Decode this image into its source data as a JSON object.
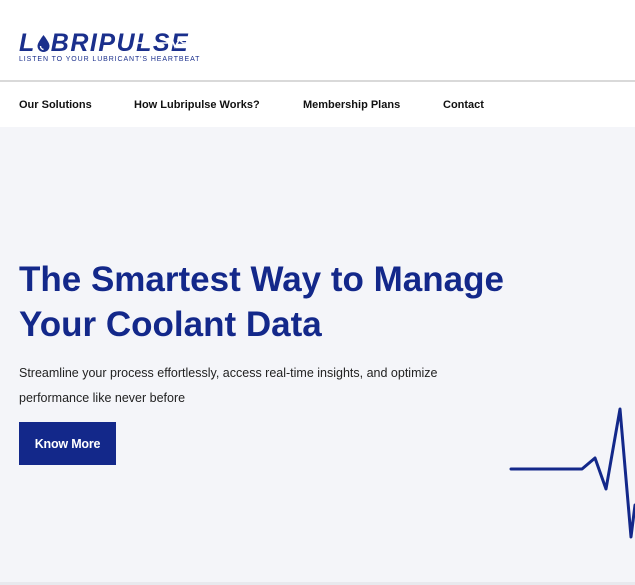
{
  "brand": {
    "wordmark_prefix": "L",
    "wordmark_rest": "BRIPULSE",
    "tagline": "LISTEN TO YOUR LUBRICANT'S HEARTBEAT",
    "color": "#1a2f8c"
  },
  "nav": {
    "items": [
      {
        "label": "Our Solutions"
      },
      {
        "label": "How Lubripulse Works?"
      },
      {
        "label": "Membership Plans"
      },
      {
        "label": "Contact"
      }
    ]
  },
  "hero": {
    "title": "The Smartest Way to Manage Your Coolant Data",
    "subtitle": "Streamline your process effortlessly, access real-time insights, and optimize performance like never before",
    "cta_label": "Know More",
    "accent": "#13288a",
    "background": "#f4f5f9",
    "decoration_icon": "heartbeat-pulse-line"
  }
}
